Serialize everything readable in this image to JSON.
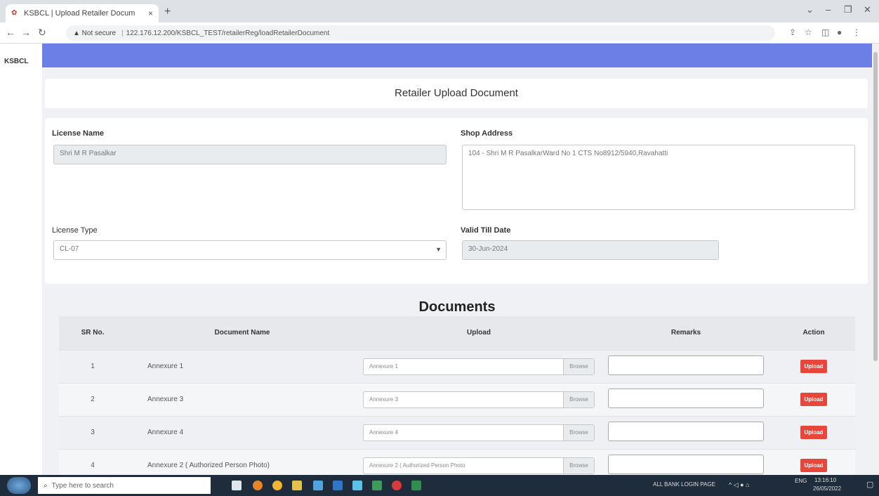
{
  "browser": {
    "tab_title": "KSBCL | Upload Retailer Docum",
    "tab_close": "×",
    "new_tab": "+",
    "address_warning": "▲ Not secure",
    "url": "122.176.12.200/KSBCL_TEST/retailerReg/loadRetailerDocument"
  },
  "brand": "KSBCL",
  "page": {
    "header_title": "Retailer Upload Document",
    "license_name_label": "License Name",
    "license_name_value": "Shri M R Pasalkar",
    "shop_address_label": "Shop Address",
    "shop_address_value": "104 - Shri M R PasalkarWard No 1 CTS No8912/5940,Ravahatti",
    "license_type_label": "License Type",
    "license_type_value": "CL-07",
    "valid_till_label": "Valid Till Date",
    "valid_till_value": "30-Jun-2024"
  },
  "documents": {
    "title": "Documents",
    "columns": {
      "sr": "SR No.",
      "name": "Document Name",
      "upload": "Upload",
      "remarks": "Remarks",
      "action": "Action"
    },
    "rows": [
      {
        "sr": "1",
        "name": "Annexure 1",
        "file": "Annexure 1",
        "browse": "Browse",
        "action": "Upload"
      },
      {
        "sr": "2",
        "name": "Annexure 3",
        "file": "Annexure 3",
        "browse": "Browse",
        "action": "Upload"
      },
      {
        "sr": "3",
        "name": "Annexure 4",
        "file": "Annexure 4",
        "browse": "Browse",
        "action": "Upload"
      },
      {
        "sr": "4",
        "name": "Annexure 2 ( Authorized Person Photo)",
        "file": "Annexure 2 ( Authorized Person Photo",
        "browse": "Browse",
        "action": "Upload"
      }
    ]
  },
  "taskbar": {
    "search_placeholder": "Type here to search",
    "tray_text": "ALL BANK LOGIN PAGE",
    "lang": "ENG",
    "time": "13:16:10",
    "date": "26/05/2022"
  }
}
